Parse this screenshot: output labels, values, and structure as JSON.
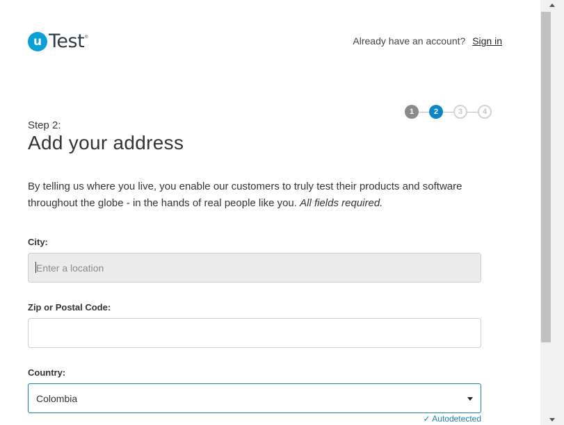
{
  "header": {
    "logo_letter": "u",
    "logo_text": "Test",
    "logo_reg": "®",
    "account_prompt": "Already have an account?",
    "sign_in_label": "Sign in"
  },
  "progress": {
    "steps": [
      "1",
      "2",
      "3",
      "4"
    ],
    "current_step": 2
  },
  "form": {
    "step_label": "Step 2:",
    "title": "Add your address",
    "intro": "By telling us where you live, you enable our customers to truly test their products and software throughout the globe - in the hands of real people like you.",
    "intro_emphasis": "All fields required.",
    "city_label": "City:",
    "city_placeholder": "Enter a location",
    "city_value": "",
    "zip_label": "Zip or Postal Code:",
    "zip_value": "",
    "country_label": "Country:",
    "country_value": "Colombia",
    "autodetected_label": "✓ Autodetected"
  },
  "colors": {
    "brand": "#0a9fd6",
    "active_step": "#0a86c7",
    "link": "#1b7fae"
  }
}
